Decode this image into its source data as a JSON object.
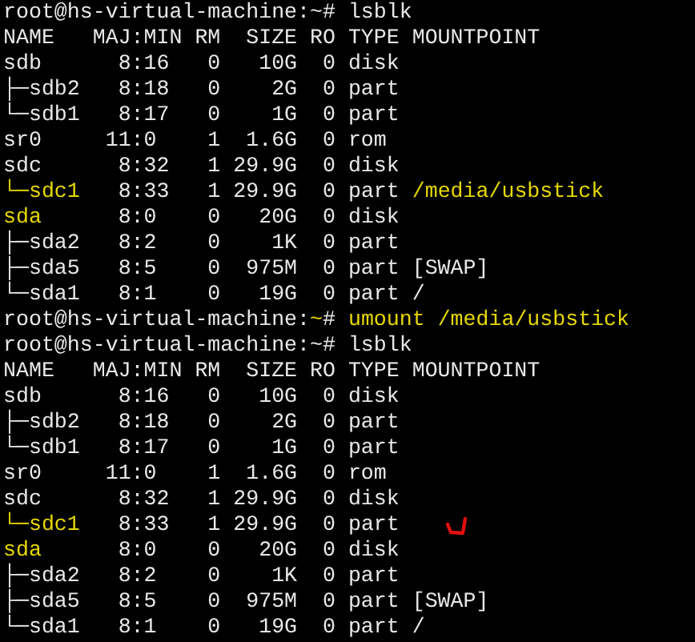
{
  "terminal": {
    "lines": [
      {
        "segments": [
          {
            "text": "root@hs-virtual-machine:~# lsblk",
            "highlight": false
          }
        ]
      },
      {
        "segments": [
          {
            "text": "NAME   MAJ:MIN RM  SIZE RO TYPE MOUNTPOINT",
            "highlight": false
          }
        ]
      },
      {
        "segments": [
          {
            "text": "sdb      8:16   0   10G  0 disk",
            "highlight": false
          }
        ]
      },
      {
        "segments": [
          {
            "text": "├─sdb2   8:18   0    2G  0 part",
            "highlight": false
          }
        ]
      },
      {
        "segments": [
          {
            "text": "└─sdb1   8:17   0    1G  0 part",
            "highlight": false
          }
        ]
      },
      {
        "segments": [
          {
            "text": "sr0     11:0    1  1.6G  0 rom",
            "highlight": false
          }
        ]
      },
      {
        "segments": [
          {
            "text": "sdc      8:32   1 29.9G  0 disk",
            "highlight": false
          }
        ]
      },
      {
        "segments": [
          {
            "text": "└─sdc1",
            "highlight": true
          },
          {
            "text": "   8:33   1 29.9G  0 part ",
            "highlight": false
          },
          {
            "text": "/media/usbstick",
            "highlight": true
          }
        ]
      },
      {
        "segments": [
          {
            "text": "sda",
            "highlight": true
          },
          {
            "text": "      8:0    0   20G  0 disk",
            "highlight": false
          }
        ]
      },
      {
        "segments": [
          {
            "text": "├─sda2   8:2    0    1K  0 part",
            "highlight": false
          }
        ]
      },
      {
        "segments": [
          {
            "text": "├─sda5   8:5    0  975M  0 part [SWAP]",
            "highlight": false
          }
        ]
      },
      {
        "segments": [
          {
            "text": "└─sda1   8:1    0   19G  0 part /",
            "highlight": false
          }
        ]
      },
      {
        "segments": [
          {
            "text": "root@hs-virtual-machine:",
            "highlight": false
          },
          {
            "text": "~",
            "highlight": true
          },
          {
            "text": "# ",
            "highlight": false
          },
          {
            "text": "umount /media/usbstick",
            "highlight": true
          }
        ]
      },
      {
        "segments": [
          {
            "text": "root@hs-virtual-machine:~# lsblk",
            "highlight": false
          }
        ]
      },
      {
        "segments": [
          {
            "text": "NAME   MAJ:MIN RM  SIZE RO TYPE MOUNTPOINT",
            "highlight": false
          }
        ]
      },
      {
        "segments": [
          {
            "text": "sdb      8:16   0   10G  0 disk",
            "highlight": false
          }
        ]
      },
      {
        "segments": [
          {
            "text": "├─sdb2   8:18   0    2G  0 part",
            "highlight": false
          }
        ]
      },
      {
        "segments": [
          {
            "text": "└─sdb1   8:17   0    1G  0 part",
            "highlight": false
          }
        ]
      },
      {
        "segments": [
          {
            "text": "sr0     11:0    1  1.6G  0 rom",
            "highlight": false
          }
        ]
      },
      {
        "segments": [
          {
            "text": "sdc      8:32   1 29.9G  0 disk",
            "highlight": false
          }
        ]
      },
      {
        "segments": [
          {
            "text": "└─sdc1",
            "highlight": true
          },
          {
            "text": "   8:33   1 29.9G  0 part",
            "highlight": false
          }
        ],
        "tick_marked": true
      },
      {
        "segments": [
          {
            "text": "sda",
            "highlight": true
          },
          {
            "text": "      8:0    0   20G  0 disk",
            "highlight": false
          }
        ]
      },
      {
        "segments": [
          {
            "text": "├─sda2   8:2    0    1K  0 part",
            "highlight": false
          }
        ]
      },
      {
        "segments": [
          {
            "text": "├─sda5   8:5    0  975M  0 part [SWAP]",
            "highlight": false
          }
        ]
      },
      {
        "segments": [
          {
            "text": "└─sda1   8:1    0   19G  0 part /",
            "highlight": false
          }
        ]
      }
    ]
  }
}
